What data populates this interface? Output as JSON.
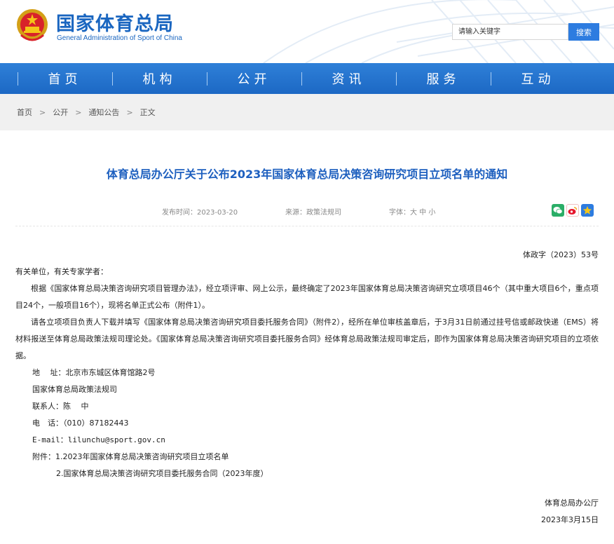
{
  "site": {
    "name_cn": "国家体育总局",
    "name_en": "General Administration of Sport of China"
  },
  "search": {
    "placeholder": "请输入关键字",
    "button": "搜索"
  },
  "nav": {
    "items": [
      "首页",
      "机构",
      "公开",
      "资讯",
      "服务",
      "互动"
    ]
  },
  "breadcrumb": {
    "items": [
      "首页",
      "公开",
      "通知公告",
      "正文"
    ],
    "separator": ">"
  },
  "article": {
    "title": "体育总局办公厅关于公布2023年国家体育总局决策咨询研究项目立项名单的通知",
    "meta": {
      "date": "发布时间：2023-03-20",
      "source": "来源：政策法规司",
      "font": "字体：大 中 小"
    },
    "share_icons": [
      "wechat-icon",
      "weibo-icon",
      "favorite-icon"
    ],
    "doc_number": "体政字（2023）53号",
    "salutation": "有关单位，有关专家学者：",
    "para1": "根据《国家体育总局决策咨询研究项目管理办法》，经立项评审、网上公示，最终确定了2023年国家体育总局决策咨询研究立项项目46个（其中重大项目6个，重点项目24个，一般项目16个），现将名单正式公布（附件1）。",
    "para2": "请各立项项目负责人下载并填写《国家体育总局决策咨询研究项目委托服务合同》（附件2），经所在单位审核盖章后，于3月31日前通过挂号信或邮政快递（EMS）将材料报送至体育总局政策法规司理论处。《国家体育总局决策咨询研究项目委托服务合同》经体育总局政策法规司审定后，即作为国家体育总局决策咨询研究项目的立项依据。",
    "address": "地　 址：北京市东城区体育馆路2号",
    "org": "国家体育总局政策法规司",
    "contact": "联系人：陈　 中",
    "phone": "电　话：（010）87182443",
    "email_label": "E-mail：",
    "email": "lilunchu@sport.gov.cn",
    "attachment1": "附件：1.2023年国家体育总局决策咨询研究项目立项名单",
    "attachment2": "2.国家体育总局决策咨询研究项目委托服务合同（2023年度）",
    "signature": "体育总局办公厅",
    "sign_date": "2023年3月15日"
  },
  "colors": {
    "brand_blue": "#1a66c0",
    "nav_blue": "#2174d0",
    "title_blue": "#1d5fbf",
    "wechat": "#2aae67",
    "weibo": "#e6162d",
    "favorite": "#2d7ce0"
  }
}
